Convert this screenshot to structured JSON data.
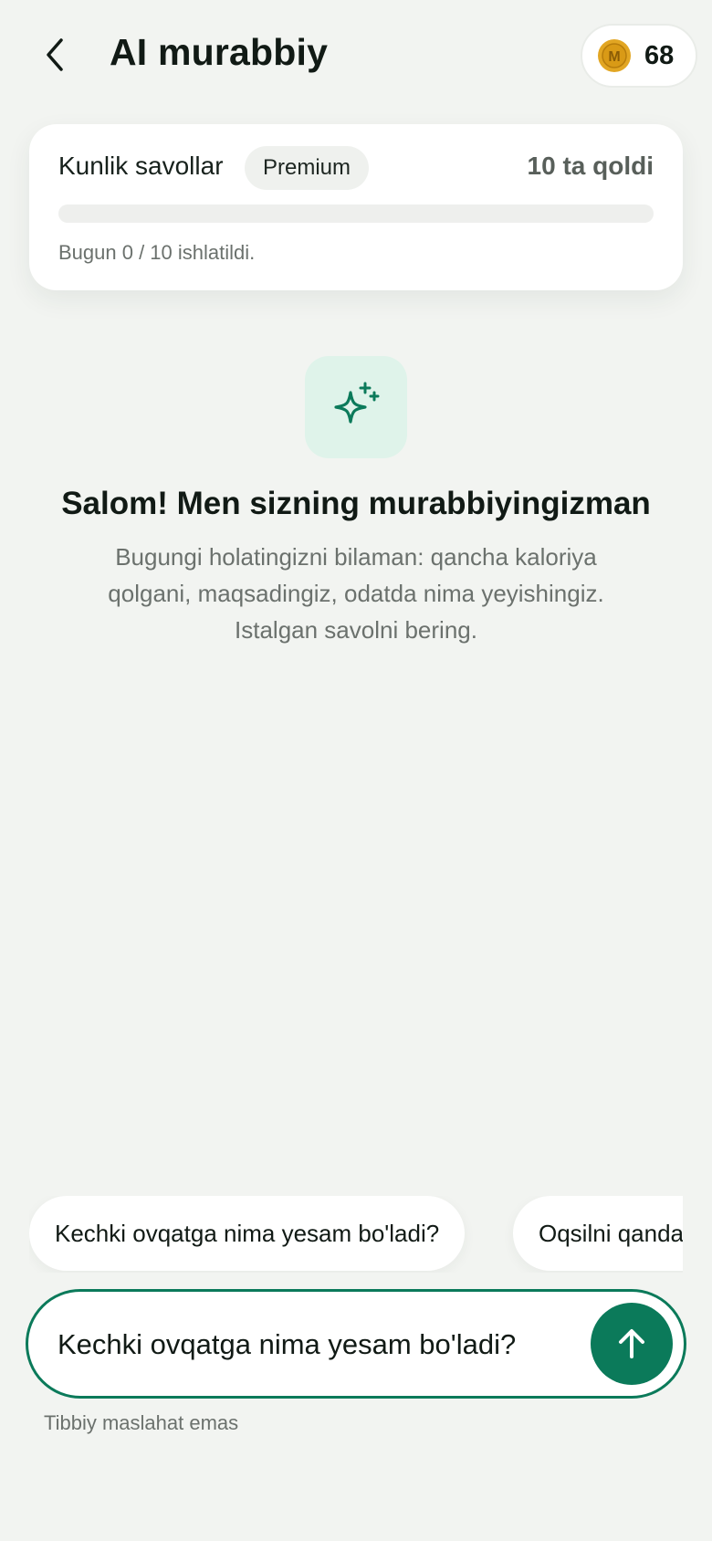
{
  "header": {
    "title": "AI murabbiy",
    "coins": "68",
    "coin_letter": "M"
  },
  "daily": {
    "label": "Kunlik savollar",
    "badge": "Premium",
    "remaining": "10 ta qoldi",
    "usage": "Bugun 0 / 10 ishlatildi.",
    "used": 0,
    "limit": 10
  },
  "welcome": {
    "title": "Salom! Men sizning murabbiyingizman",
    "description": "Bugungi holatingizni bilaman: qancha kaloriya qolgani, maqsadingiz, odatda nima yeyishingiz. Istalgan savolni bering."
  },
  "suggestions": [
    "Kechki ovqatga nima yesam bo'ladi?",
    "Oqsilni qanday"
  ],
  "input": {
    "value": "Kechki ovqatga nima yesam bo'ladi?"
  },
  "disclaimer": "Tibbiy maslahat emas",
  "colors": {
    "accent": "#0b7a5a",
    "background": "#f2f4f1",
    "coin": "#e2a623"
  },
  "icons": {
    "back": "chevron-left-icon",
    "coin": "coin-icon",
    "sparkle": "sparkle-icon",
    "send": "arrow-up-icon"
  }
}
